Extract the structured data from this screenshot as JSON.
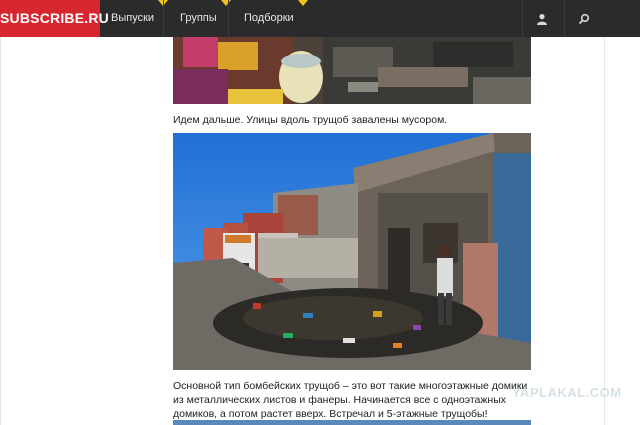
{
  "header": {
    "logo": "SUBSCRIBE.RU",
    "nav": [
      {
        "label": "Выпуски"
      },
      {
        "label": "Группы"
      },
      {
        "label": "Подборки"
      }
    ],
    "icons": [
      "user-icon",
      "search-icon"
    ],
    "colors": {
      "bar": "#2b2b2b",
      "logo_bg": "#d6262f",
      "flag": "#f0c419"
    }
  },
  "article": {
    "paragraph_1": "Идем дальше. Улицы вдоль трущоб завалены мусором.",
    "paragraph_2": "Основной тип бомбейских трущоб – это вот такие многоэтажные домики из металлических листов и фанеры. Начинается все с одноэтажных домиков, а потом растет вверх. Встречал и 5-этажные трущобы!"
  },
  "watermark": "YAPLAKAL.COM"
}
